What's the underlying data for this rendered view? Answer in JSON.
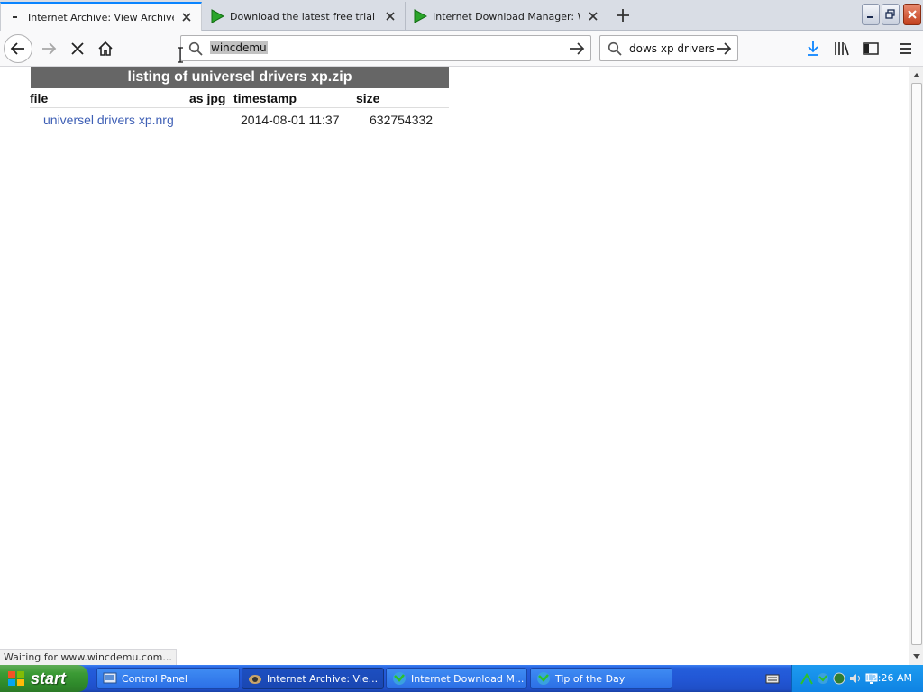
{
  "tabs": [
    {
      "title": "Internet Archive: View Archive",
      "active": true
    },
    {
      "title": "Download the latest free trial versi",
      "active": false
    },
    {
      "title": "Internet Download Manager: Welc",
      "active": false
    }
  ],
  "toolbar": {
    "url_value": "wincdemu",
    "search_value": "dows xp drivers"
  },
  "listing": {
    "title": "listing of universel drivers xp.zip",
    "headers": {
      "file": "file",
      "as_jpg": "as jpg",
      "timestamp": "timestamp",
      "size": "size"
    },
    "rows": [
      {
        "file": "universel drivers xp.nrg",
        "timestamp": "2014-08-01 11:37",
        "size": "632754332"
      }
    ]
  },
  "status_text": "Waiting for www.wincdemu.com...",
  "taskbar": {
    "start_label": "start",
    "tasks": [
      {
        "label": "Control Panel",
        "active": false
      },
      {
        "label": "Internet Archive: Vie...",
        "active": true
      },
      {
        "label": "Internet Download M...",
        "active": false
      },
      {
        "label": "Tip of the Day",
        "active": false
      }
    ],
    "clock": "12:26 AM"
  },
  "colors": {
    "accent": "#0a84ff",
    "link": "#3e5fb5",
    "listing_header_bg": "#666666",
    "taskbar_blue": "#245edb",
    "start_green": "#3c9b35"
  }
}
